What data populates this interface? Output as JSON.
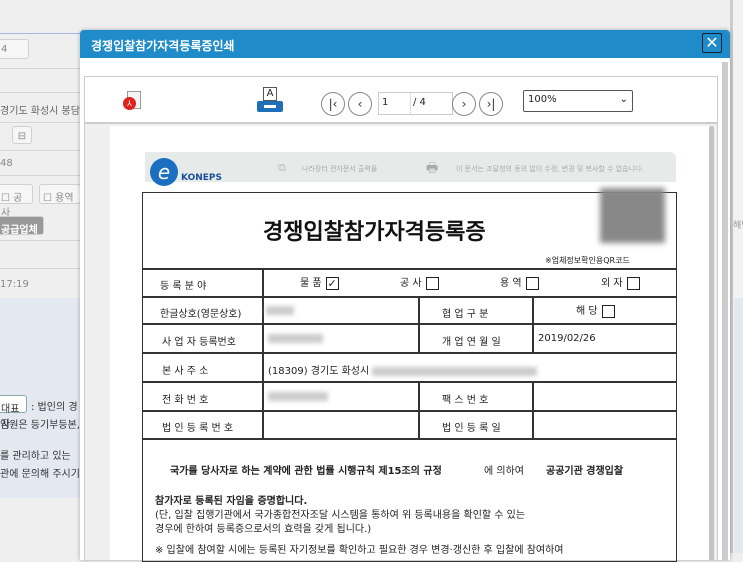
{
  "background": {
    "fields": [
      "4",
      "경기도 화성시 봉담",
      "48",
      "17:19"
    ],
    "checkboxes": [
      "공사",
      "용역"
    ],
    "supplier_button": "공급업체",
    "representative_button": "대표자",
    "notes": [
      ": 법인의 경",
      "임원은 등기부등본,",
      "를 관리하고 있는",
      "관에 문의해 주시기"
    ],
    "right_clip": "해당"
  },
  "dialog": {
    "title": "경쟁입찰참가자격등록증인쇄",
    "close_icon": "close-icon",
    "toolbar": {
      "current_page": "1",
      "total_pages": "/ 4",
      "zoom": "100%"
    }
  },
  "document": {
    "header_left": "나라장터 전자문서 출력물",
    "header_right": "이 문서는 조달청의 동의 없이 수정, 변경 및 복사할 수 없습니다.",
    "logo_text": "KONEPS",
    "title": "경쟁입찰참가자격등록증",
    "qr_caption": "※업체정보확인용QR코드",
    "rows": {
      "field_label": "등 록 분 야",
      "fields": [
        {
          "label": "물 품",
          "checked": true
        },
        {
          "label": "공 사",
          "checked": false
        },
        {
          "label": "용 역",
          "checked": false
        },
        {
          "label": "외 자",
          "checked": false
        }
      ],
      "company_label": "한글상호(영문상호)",
      "coop_label": "협 업 구 분",
      "coop_value": "해 당",
      "bizno_label": "사 업 자 등록번호",
      "open_label": "개 업 연 월 일",
      "open_value": "2019/02/26",
      "addr_label": "본 사 주 소",
      "addr_value": "(18309) 경기도 화성시",
      "phone_label": "전 화 번 호",
      "fax_label": "팩 스 번 호",
      "corp_no_label": "법 인 등 록 번 호",
      "corp_date_label": "법 인 등 록 일"
    },
    "law_text": "국가를 당사자로 하는 계약에 관한 법률 시행규칙 제15조의 규정",
    "law_by": "에 의하여",
    "law_target": "공공기관 경쟁입찰",
    "cert_line": "참가자로 등록된 자임을 증명합니다.",
    "note1": "(단, 입찰 집행기관에서 국가종합전자조달 시스템을 통하여 위 등록내용을 확인할 수 있는",
    "note2": "경우에 한하여 등록증으로서의 효력을 갖게 됩니다.)",
    "note3": "※ 입찰에 참여할 시에는 등록된 자기정보를 확인하고 필요한 경우 변경·갱신한 후 입찰에 참여하여"
  }
}
